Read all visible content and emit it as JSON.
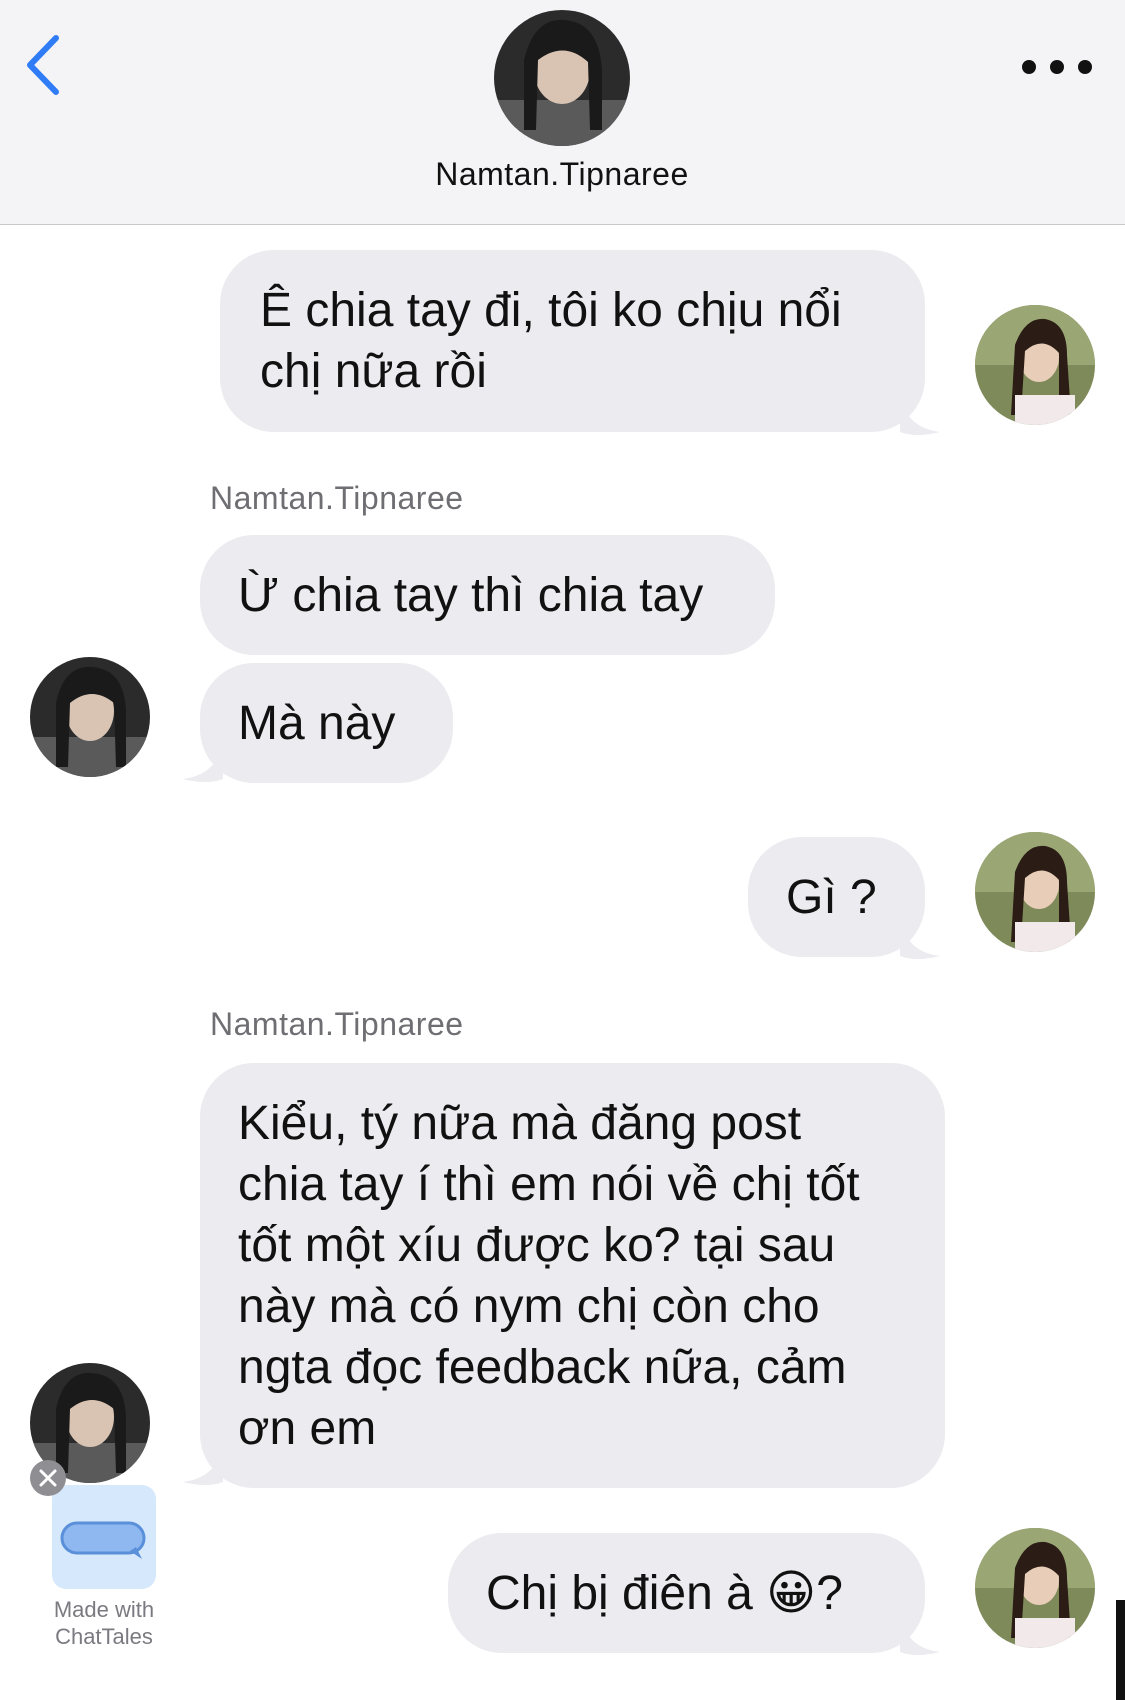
{
  "header": {
    "contact_name": "Namtan.Tipnaree",
    "back_icon": "chevron-left-icon",
    "more_icon": "ellipsis-icon",
    "accent_color": "#2f7cf6"
  },
  "messages": [
    {
      "direction": "outgoing",
      "text": "Ê chia tay đi, tôi ko chịu nổi\nchị nữa rồi"
    },
    {
      "direction": "incoming",
      "sender": "Namtan.Tipnaree",
      "text": "Ừ chia tay thì chia tay"
    },
    {
      "direction": "incoming",
      "text": "Mà này"
    },
    {
      "direction": "outgoing",
      "text": "Gì ?"
    },
    {
      "direction": "incoming",
      "sender": "Namtan.Tipnaree",
      "text": "Kiểu, tý nữa mà đăng post\nchia tay í thì em nói về chị tốt\ntốt một xíu được ko? tại sau\nnày mà có nym chị còn cho\nngta đọc feedback nữa, cảm\nơn em"
    },
    {
      "direction": "outgoing",
      "text": "Chị bị điên à 😀?"
    }
  ],
  "badge": {
    "label": "Made with\nChatTales",
    "icon": "chat-bubble-icon",
    "close_icon": "close-icon"
  },
  "colors": {
    "bubble_bg": "#ebebf0",
    "header_bg": "#f4f4f6"
  }
}
